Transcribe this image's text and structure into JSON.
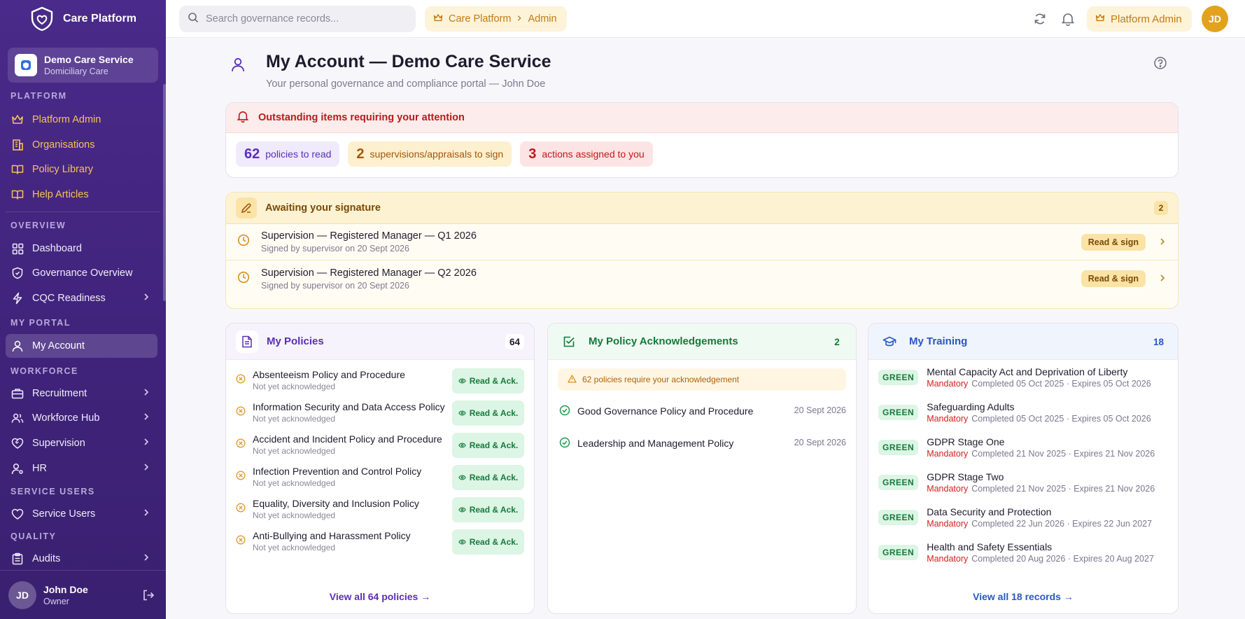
{
  "brand": {
    "name": "Care Platform"
  },
  "org": {
    "name": "Demo Care Service",
    "type": "Domiciliary Care"
  },
  "sidebar": {
    "sections": {
      "platform": "PLATFORM",
      "overview": "OVERVIEW",
      "my_portal": "MY PORTAL",
      "workforce": "WORKFORCE",
      "service_users": "SERVICE USERS",
      "quality": "QUALITY"
    },
    "items": {
      "platform_admin": "Platform Admin",
      "organisations": "Organisations",
      "policy_library": "Policy Library",
      "help_articles": "Help Articles",
      "dashboard": "Dashboard",
      "governance_overview": "Governance Overview",
      "cqc_readiness": "CQC Readiness",
      "my_account": "My Account",
      "recruitment": "Recruitment",
      "workforce_hub": "Workforce Hub",
      "supervision": "Supervision",
      "hr": "HR",
      "service_users": "Service Users",
      "audits": "Audits"
    },
    "user": {
      "initials": "JD",
      "name": "John Doe",
      "role": "Owner"
    }
  },
  "topbar": {
    "search_placeholder": "Search governance records...",
    "breadcrumb": {
      "root": "Care Platform",
      "current": "Admin"
    },
    "admin_label": "Platform Admin",
    "avatar_initials": "JD"
  },
  "page": {
    "title": "My Account — Demo Care Service",
    "subtitle": "Your personal governance and compliance portal — John Doe"
  },
  "alert": {
    "heading": "Outstanding items requiring your attention",
    "chips": {
      "policies": {
        "count": "62",
        "label": "policies to read"
      },
      "supervisions": {
        "count": "2",
        "label": "supervisions/appraisals to sign"
      },
      "actions": {
        "count": "3",
        "label": "actions assigned to you"
      }
    }
  },
  "signature": {
    "heading": "Awaiting your signature",
    "count": "2",
    "items": [
      {
        "title": "Supervision — Registered Manager — Q1 2026",
        "sub": "Signed by supervisor on 20 Sept 2026",
        "button": "Read & sign"
      },
      {
        "title": "Supervision — Registered Manager — Q2 2026",
        "sub": "Signed by supervisor on 20 Sept 2026",
        "button": "Read & sign"
      }
    ]
  },
  "policies": {
    "heading": "My Policies",
    "count": "64",
    "button_label": "Read & Ack.",
    "items": [
      {
        "title": "Absenteeism Policy and Procedure",
        "status": "Not yet acknowledged"
      },
      {
        "title": "Information Security and Data Access Policy",
        "status": "Not yet acknowledged"
      },
      {
        "title": "Accident and Incident Policy and Procedure",
        "status": "Not yet acknowledged"
      },
      {
        "title": "Infection Prevention and Control Policy",
        "status": "Not yet acknowledged"
      },
      {
        "title": "Equality, Diversity and Inclusion Policy",
        "status": "Not yet acknowledged"
      },
      {
        "title": "Anti-Bullying and Harassment Policy",
        "status": "Not yet acknowledged"
      }
    ],
    "view_all": "View all 64 policies →"
  },
  "acknowledgements": {
    "heading": "My Policy Acknowledgements",
    "count": "2",
    "banner": "62 policies require your acknowledgement",
    "items": [
      {
        "title": "Good Governance Policy and Procedure",
        "date": "20 Sept 2026"
      },
      {
        "title": "Leadership and Management Policy",
        "date": "20 Sept 2026"
      }
    ]
  },
  "training": {
    "heading": "My Training",
    "count": "18",
    "mandatory_label": "Mandatory",
    "items": [
      {
        "rag": "GREEN",
        "title": "Mental Capacity Act and Deprivation of Liberty",
        "dates": "Completed 05 Oct 2025 · Expires 05 Oct 2026"
      },
      {
        "rag": "GREEN",
        "title": "Safeguarding Adults",
        "dates": "Completed 05 Oct 2025 · Expires 05 Oct 2026"
      },
      {
        "rag": "GREEN",
        "title": "GDPR Stage One",
        "dates": "Completed 21 Nov 2025 · Expires 21 Nov 2026"
      },
      {
        "rag": "GREEN",
        "title": "GDPR Stage Two",
        "dates": "Completed 21 Nov 2025 · Expires 21 Nov 2026"
      },
      {
        "rag": "GREEN",
        "title": "Data Security and Protection",
        "dates": "Completed 22 Jun 2026 · Expires 22 Jun 2027"
      },
      {
        "rag": "GREEN",
        "title": "Health and Safety Essentials",
        "dates": "Completed 20 Aug 2026 · Expires 20 Aug 2027"
      }
    ],
    "view_all": "View all 18 records →"
  },
  "colors": {
    "sidebar": "#4a2a8a",
    "accent_gold": "#f5c451",
    "alert_red": "#c0171b",
    "green": "#147a3a",
    "blue": "#2857c5"
  },
  "icons": {
    "brand": "shield-heart-icon",
    "search": "search-icon",
    "refresh": "refresh-icon",
    "bell": "bell-icon",
    "crown": "crown-icon",
    "help": "help-circle-icon",
    "pen": "pen-icon",
    "clock": "clock-icon"
  }
}
